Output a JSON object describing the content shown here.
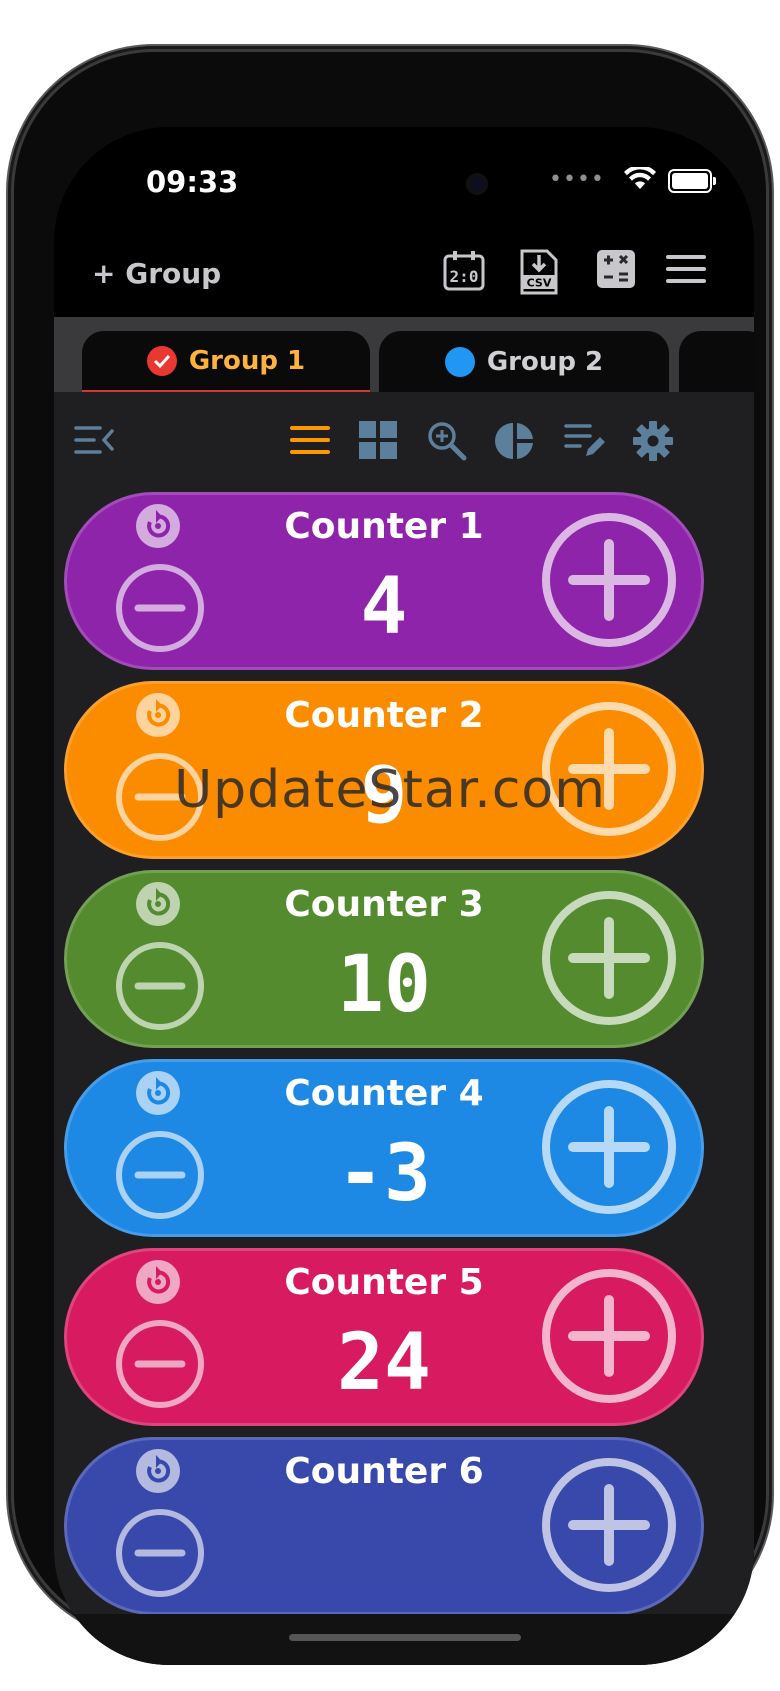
{
  "status": {
    "time": "09:33"
  },
  "toolbar": {
    "add_group": "+ Group",
    "csv_label": "CSV"
  },
  "tabs": [
    {
      "label": "Group 1",
      "color": "#e8382f",
      "active": true
    },
    {
      "label": "Group 2",
      "color": "#2196f3",
      "active": false
    }
  ],
  "counters": [
    {
      "name": "Counter 1",
      "value": "4",
      "color": "#8e24aa"
    },
    {
      "name": "Counter 2",
      "value": "9",
      "color": "#fb8c00"
    },
    {
      "name": "Counter 3",
      "value": "10",
      "color": "#558b2f"
    },
    {
      "name": "Counter 4",
      "value": "-3",
      "color": "#1e88e5"
    },
    {
      "name": "Counter 5",
      "value": "24",
      "color": "#d81b60"
    },
    {
      "name": "Counter 6",
      "value": "",
      "color": "#3949ab"
    }
  ],
  "watermark": "UpdateStar.com"
}
